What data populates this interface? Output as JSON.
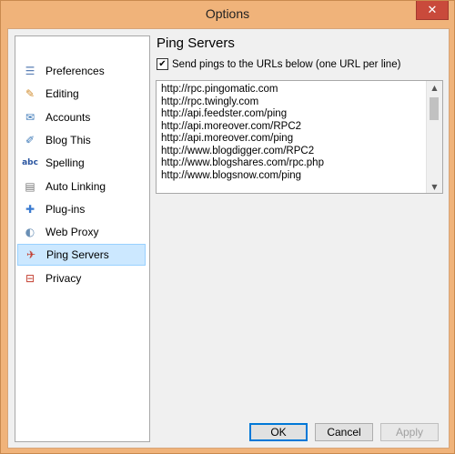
{
  "window": {
    "title": "Options",
    "close_glyph": "✕"
  },
  "nav": {
    "items": [
      {
        "label": "Preferences",
        "icon": "preferences-icon",
        "glyph": "☰",
        "color": "#5a7fb5"
      },
      {
        "label": "Editing",
        "icon": "pencil-icon",
        "glyph": "✎",
        "color": "#d08a2a"
      },
      {
        "label": "Accounts",
        "icon": "accounts-icon",
        "glyph": "✉",
        "color": "#3e7ab8"
      },
      {
        "label": "Blog This",
        "icon": "blog-this-icon",
        "glyph": "✐",
        "color": "#3e7ab8"
      },
      {
        "label": "Spelling",
        "icon": "spelling-icon",
        "glyph": "abc",
        "color": "#2a55a0"
      },
      {
        "label": "Auto Linking",
        "icon": "document-icon",
        "glyph": "▤",
        "color": "#777777"
      },
      {
        "label": "Plug-ins",
        "icon": "puzzle-icon",
        "glyph": "✚",
        "color": "#3a7ad0"
      },
      {
        "label": "Web Proxy",
        "icon": "globe-icon",
        "glyph": "◐",
        "color": "#6a8fb5"
      },
      {
        "label": "Ping Servers",
        "icon": "ping-icon",
        "glyph": "✈",
        "color": "#c33d2f"
      },
      {
        "label": "Privacy",
        "icon": "privacy-icon",
        "glyph": "⊟",
        "color": "#c33d2f"
      }
    ],
    "selected_index": 8
  },
  "panel": {
    "heading": "Ping Servers",
    "checkbox_label": "Send pings to the URLs below (one URL per line)",
    "checkbox_checked": true,
    "checkbox_glyph": "✔",
    "urls": [
      "http://rpc.pingomatic.com",
      "http://rpc.twingly.com",
      "http://api.feedster.com/ping",
      "http://api.moreover.com/RPC2",
      "http://api.moreover.com/ping",
      "http://www.blogdigger.com/RPC2",
      "http://www.blogshares.com/rpc.php",
      "http://www.blogsnow.com/ping"
    ]
  },
  "buttons": {
    "ok": "OK",
    "cancel": "Cancel",
    "apply": "Apply"
  },
  "colors": {
    "accent": "#0078d7",
    "selection": "#cce8ff",
    "frame": "#f0b37a",
    "close": "#c94a3b"
  }
}
